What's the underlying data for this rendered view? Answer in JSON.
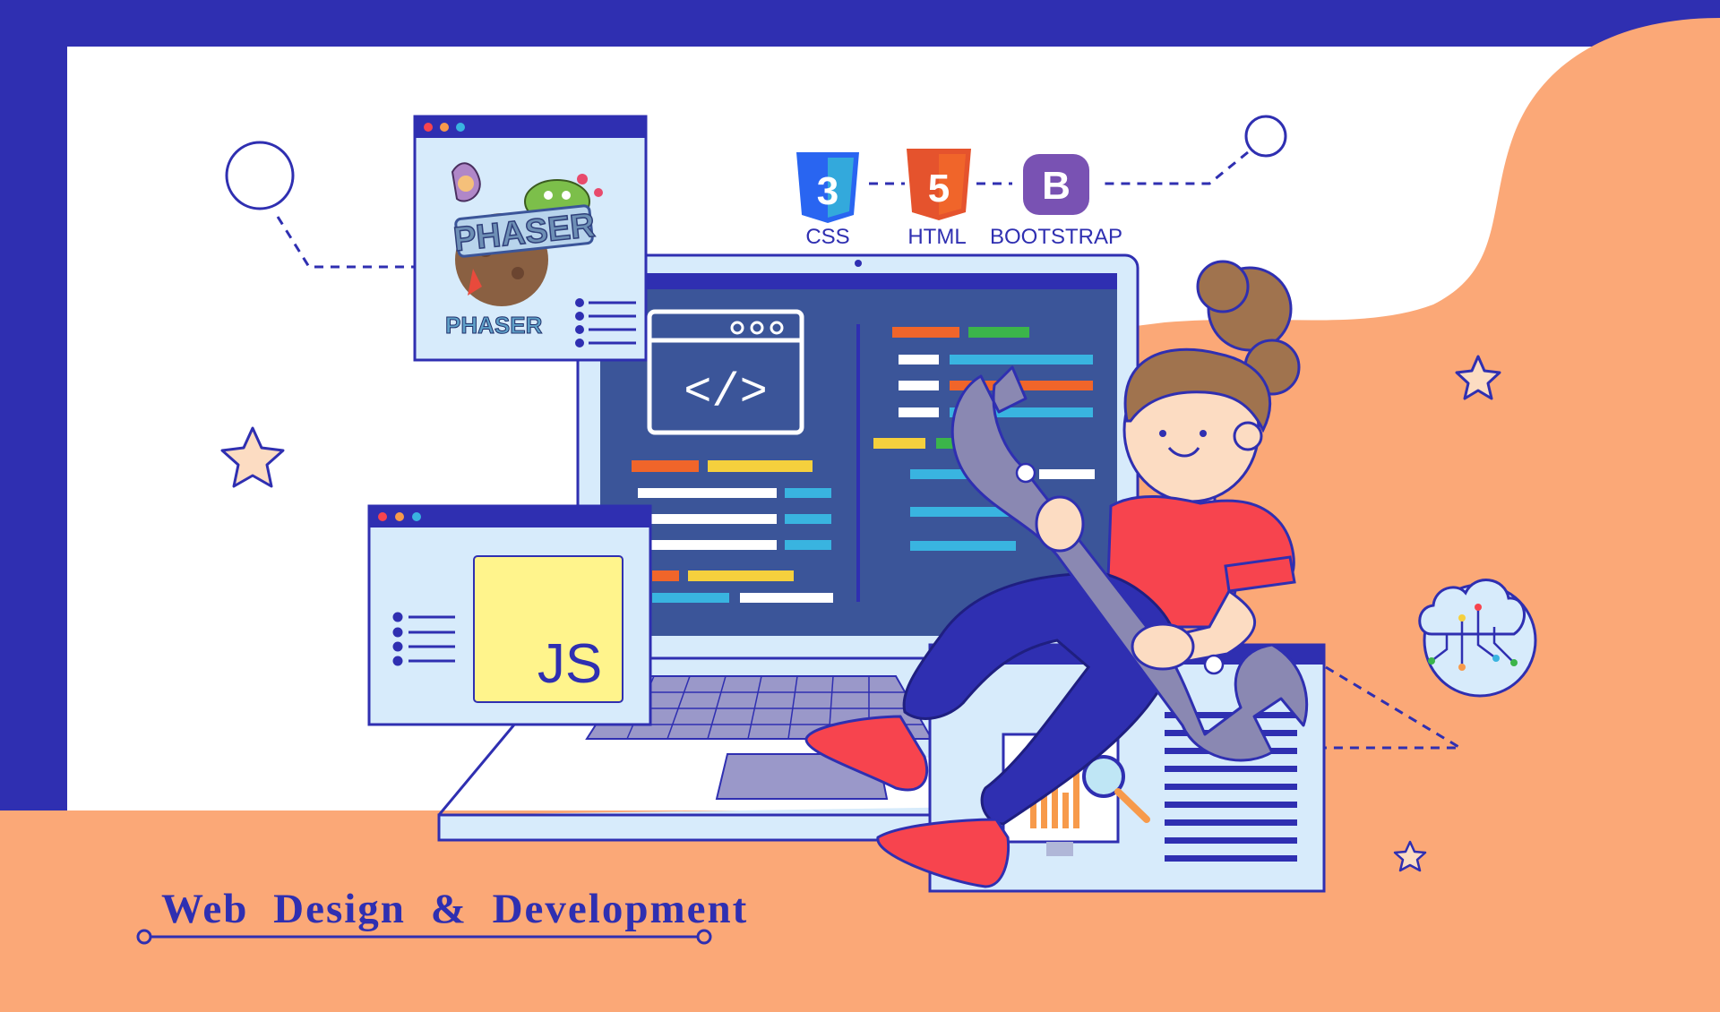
{
  "colors": {
    "navy": "#2f2fb1",
    "orange": "#fba877",
    "white": "#ffffff",
    "window_bg": "#d7ebfb",
    "screen": "#3b5599",
    "red": "#f7444e",
    "yellow": "#fff48c",
    "skin": "#fcdcc2",
    "hair": "#a0734e",
    "wrench": "#8a88b2"
  },
  "tech_badges": [
    {
      "icon": "css3-icon",
      "label": "CSS",
      "glyph": "3",
      "color": "#2965f1"
    },
    {
      "icon": "html5-icon",
      "label": "HTML",
      "glyph": "5",
      "color": "#e5532d"
    },
    {
      "icon": "bootstrap-icon",
      "label": "BOOTSTRAP",
      "glyph": "B",
      "color": "#7952b3"
    }
  ],
  "windows": {
    "phaser": {
      "logo_text": "PHASER",
      "logo_small": "PHASER"
    },
    "js": {
      "label": "JS"
    },
    "code": {
      "glyph": "</>"
    }
  },
  "headline": "Web Design & Development",
  "icons": [
    "code-window-icon",
    "cloud-circuit-icon",
    "magnifier-icon",
    "bar-chart-icon",
    "wrench-icon",
    "star-icon",
    "circle-node-icon"
  ]
}
